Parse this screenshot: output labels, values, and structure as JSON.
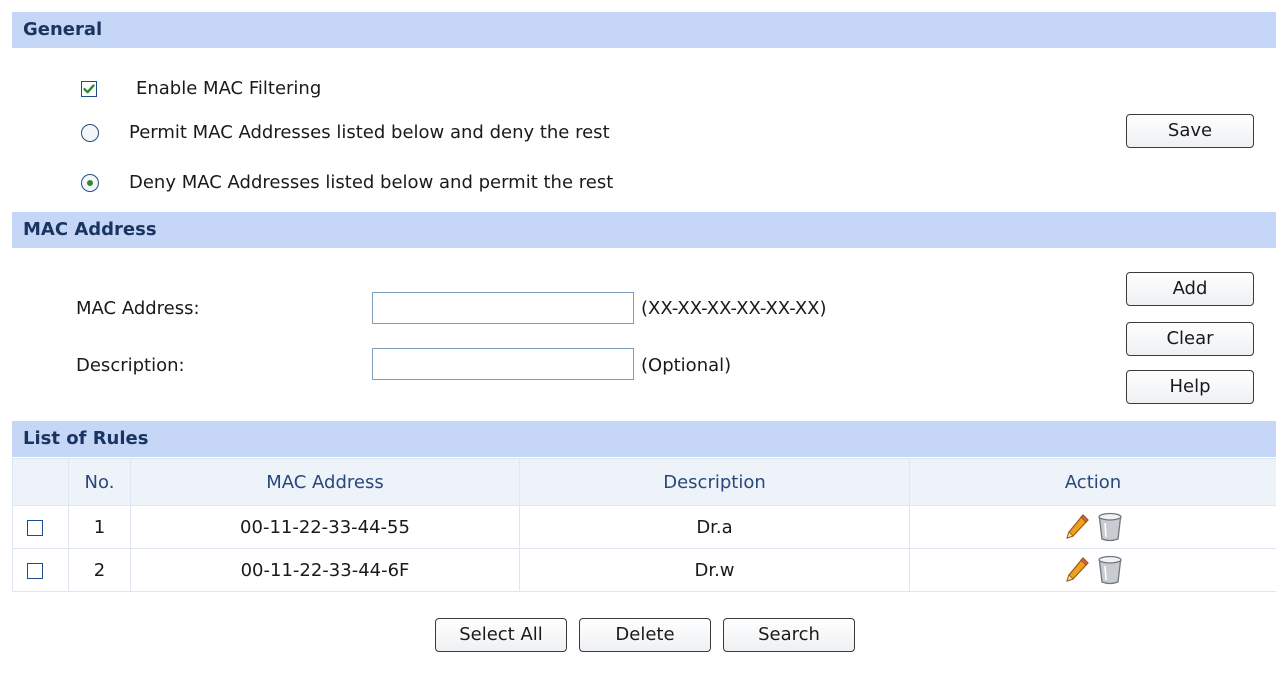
{
  "general": {
    "header": "General",
    "enable_label": "Enable MAC Filtering",
    "enable_checked": true,
    "permit_label": "Permit MAC Addresses listed below and deny the rest",
    "deny_label": "Deny MAC Addresses listed below and permit the rest",
    "selected_mode": "deny",
    "save_label": "Save"
  },
  "mac_section": {
    "header": "MAC Address",
    "mac_label": "MAC Address:",
    "mac_value": "",
    "mac_hint": "(XX-XX-XX-XX-XX-XX)",
    "desc_label": "Description:",
    "desc_value": "",
    "desc_hint": "(Optional)",
    "add_label": "Add",
    "clear_label": "Clear",
    "help_label": "Help"
  },
  "rules": {
    "header": "List of Rules",
    "columns": [
      "No.",
      "MAC Address",
      "Description",
      "Action"
    ],
    "rows": [
      {
        "no": "1",
        "mac": "00-11-22-33-44-55",
        "description": "Dr.a",
        "action_icons": [
          "edit-pencil-icon",
          "delete-trash-icon"
        ]
      },
      {
        "no": "2",
        "mac": "00-11-22-33-44-6F",
        "description": "Dr.w",
        "action_icons": [
          "edit-pencil-icon",
          "delete-trash-icon"
        ]
      }
    ]
  },
  "bottom_buttons": {
    "select_all": "Select All",
    "delete": "Delete",
    "search": "Search"
  },
  "colors": {
    "section_header_bg": "#c5d6f7",
    "section_header_text": "#19345f",
    "table_header_bg": "#eef2f9",
    "check_green": "#2f8a2f",
    "pencil_orange": "#e8900f"
  }
}
